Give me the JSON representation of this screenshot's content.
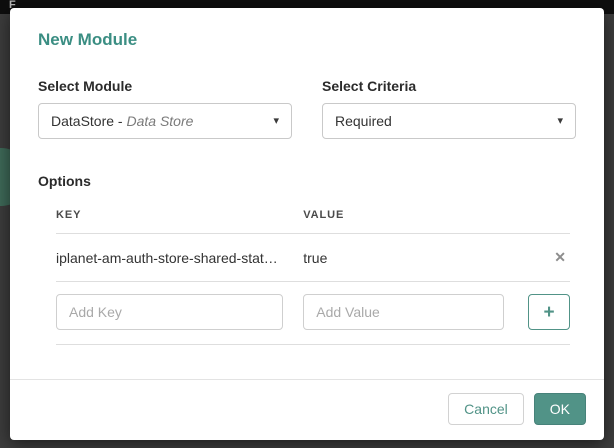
{
  "background": {
    "brand_letter": "F"
  },
  "modal": {
    "title": "New Module",
    "select_module": {
      "label": "Select Module",
      "value_prefix": "DataStore - ",
      "value_suffix": "Data Store"
    },
    "select_criteria": {
      "label": "Select Criteria",
      "value": "Required"
    },
    "options": {
      "heading": "Options",
      "columns": [
        "KEY",
        "VALUE"
      ],
      "rows": [
        {
          "key": "iplanet-am-auth-store-shared-state-…",
          "value": "true"
        }
      ],
      "add_key_placeholder": "Add Key",
      "add_value_placeholder": "Add Value"
    },
    "icons": {
      "caret": "▾",
      "remove": "✕",
      "add": "+"
    },
    "footer": {
      "cancel_label": "Cancel",
      "ok_label": "OK"
    },
    "accent_color": "#519387"
  }
}
